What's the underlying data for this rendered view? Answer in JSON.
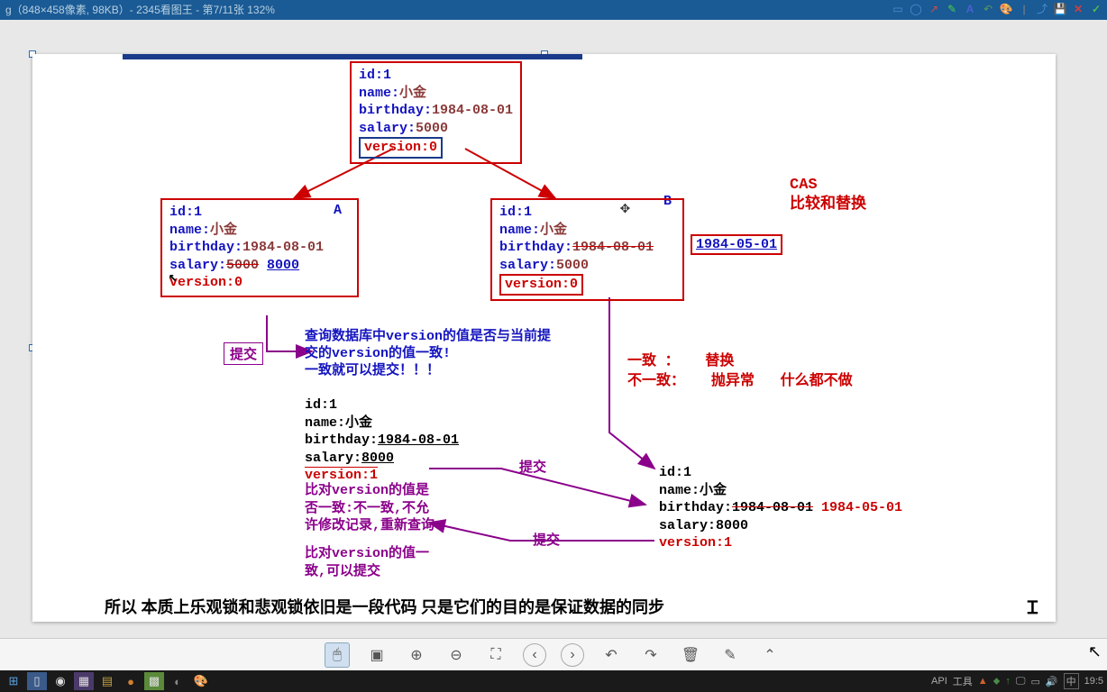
{
  "titlebar": {
    "text": "g（848×458像素, 98KB）- 2345看图王 - 第7/11张 132%"
  },
  "toolbar_icons": [
    "rect",
    "circle",
    "arrow",
    "brush",
    "text",
    "rotate",
    "palette",
    "sep",
    "share",
    "save",
    "close",
    "check"
  ],
  "diagram": {
    "top_box": {
      "id": "id:1",
      "name_k": "name:",
      "name_v": "小金",
      "bday_k": "birthday:",
      "bday_v": "1984-08-01",
      "sal_k": "salary:",
      "sal_v": "5000",
      "ver": "version:0"
    },
    "box_a": {
      "label": "A",
      "id": "id:1",
      "name_k": "name:",
      "name_v": "小金",
      "bday_k": "birthday:",
      "bday_v": "1984-08-01",
      "sal_k": "salary:",
      "sal_old": "5000",
      "sal_new": "8000",
      "ver": "version:0"
    },
    "box_b": {
      "label": "B",
      "id": "id:1",
      "name_k": "name:",
      "name_v": "小金",
      "bday_k": "birthday:",
      "bday_old": "1984-08-01",
      "bday_new": "1984-05-01",
      "sal_k": "salary:",
      "sal_v": "5000",
      "ver": "version:0"
    },
    "cas": {
      "line1": "CAS",
      "line2": "比较和替换"
    },
    "submit1": "提交",
    "query_note": {
      "l1": "查询数据库中version的值是否与当前提",
      "l2": "交的version的值一致!",
      "l3": "一致就可以提交！！！"
    },
    "outcome": {
      "l1a": "一致  ：",
      "l1b": "替换",
      "l2a": "不一致：",
      "l2b": "抛异常",
      "l2c": "什么都不做"
    },
    "mid_box": {
      "id": "id:1",
      "name_k": "name:",
      "name_v": "小金",
      "bday_k": "birthday:",
      "bday_v": "1984-08-01",
      "sal_k": "salary:",
      "sal_v": "8000",
      "ver": "version:1"
    },
    "submit2": "提交",
    "compare_fail": {
      "l1": "比对version的值是",
      "l2": "否一致:不一致,不允",
      "l3": "许修改记录,重新查询"
    },
    "submit3": "提交",
    "compare_ok": {
      "l1": "比对version的值一",
      "l2": "致,可以提交"
    },
    "right_box": {
      "id": "id:1",
      "name_k": "name:",
      "name_v": "小金",
      "bday_k": "birthday:",
      "bday_old": "1984-08-01",
      "bday_new": "1984-05-01",
      "sal_k": "salary:",
      "sal_v": "8000",
      "ver": "version:1"
    },
    "bottom": "所以   本质上乐观锁和悲观锁依旧是一段代码   只是它们的目的是保证数据的同步"
  },
  "bottom_toolbar": {
    "items": [
      "pointer",
      "crop",
      "zoom-in",
      "zoom-out",
      "fit",
      "prev",
      "next",
      "undo",
      "redo",
      "delete",
      "edit",
      "more"
    ]
  },
  "taskbar": {
    "apps": [
      "start",
      "task",
      "chrome",
      "code",
      "folder",
      "ball",
      "img",
      "music",
      "paint"
    ],
    "tray": {
      "api": "API",
      "tools": "工具",
      "time": "19:5",
      "ime": "中"
    }
  }
}
